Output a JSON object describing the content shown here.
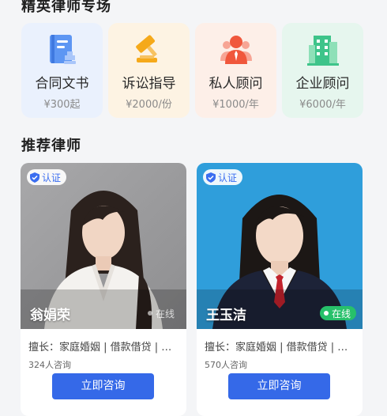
{
  "sections": {
    "services_title": "精英律师专场",
    "lawyers_title": "推荐律师"
  },
  "services": [
    {
      "name": "合同文书",
      "price": "¥300起",
      "bg": "#eaf1fd",
      "icon": "contract-document-icon",
      "icon_color": "#4d8af0"
    },
    {
      "name": "诉讼指导",
      "price": "¥2000/份",
      "bg": "#fdf3e3",
      "icon": "gavel-icon",
      "icon_color": "#f2ab1c"
    },
    {
      "name": "私人顾问",
      "price": "¥1000/年",
      "bg": "#fdefe8",
      "icon": "personal-advisor-icon",
      "icon_color": "#f0664a"
    },
    {
      "name": "企业顾问",
      "price": "¥6000/年",
      "bg": "#e6f6ee",
      "icon": "enterprise-building-icon",
      "icon_color": "#35c083"
    }
  ],
  "lawyers": [
    {
      "name": "翁娟荣",
      "badge": "认证",
      "status": "在线",
      "skill": "擅长：家庭婚姻 | 借款借贷 | 合...",
      "consults": "324人咨询",
      "button": "立即咨询"
    },
    {
      "name": "王玉洁",
      "badge": "认证",
      "status": "在线",
      "skill": "擅长：家庭婚姻 | 借款借贷 | 劳...",
      "consults": "570人咨询",
      "button": "立即咨询"
    }
  ],
  "colors": {
    "accent": "#3569e8",
    "online": "#27c06a",
    "verify": "#3a6df0"
  }
}
